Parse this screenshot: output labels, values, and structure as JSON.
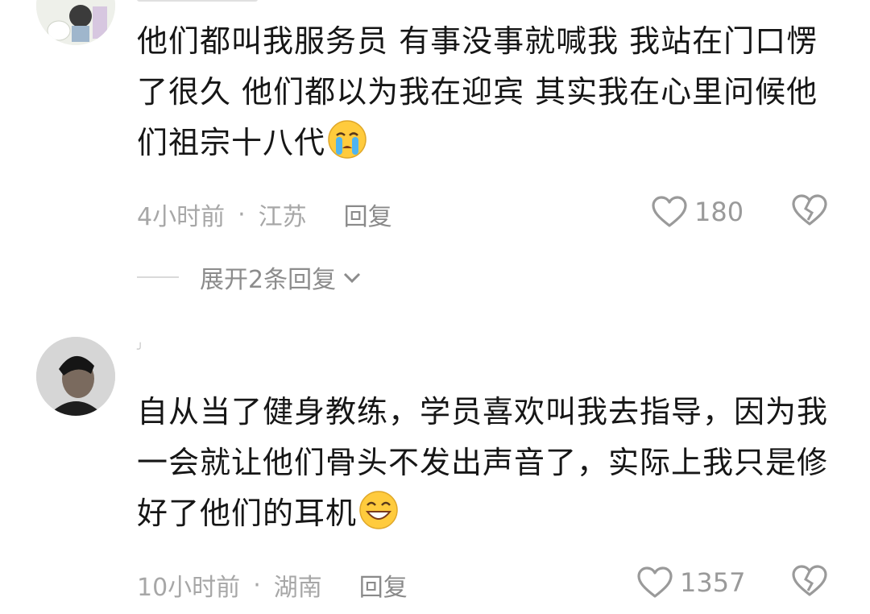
{
  "comments": [
    {
      "text": "他们都叫我服务员 有事没事就喊我 我站在门口愣了很久 他们都以为我在迎宾 其实我在心里问候他们祖宗十八代",
      "emoji": "loudly-crying-face",
      "time": "4小时前",
      "separator": "·",
      "location": "江苏",
      "reply_label": "回复",
      "likes": "180",
      "expand_replies_label": "展开2条回复"
    },
    {
      "username_mark": "╯",
      "text": "自从当了健身教练，学员喜欢叫我去指导，因为我一会就让他们骨头不发出声音了，实际上我只是修好了他们的耳机",
      "emoji": "grinning-squinting-face",
      "time": "10小时前",
      "separator": "·",
      "location": "湖南",
      "reply_label": "回复",
      "likes": "1357"
    }
  ],
  "icons": {
    "like": "heart-outline-icon",
    "dislike": "broken-heart-outline-icon",
    "expand": "chevron-down-icon"
  },
  "colors": {
    "text": "#161616",
    "meta": "#a7a7a7",
    "action": "#9a9a9a",
    "emoji_face": "#ffcb3d"
  }
}
